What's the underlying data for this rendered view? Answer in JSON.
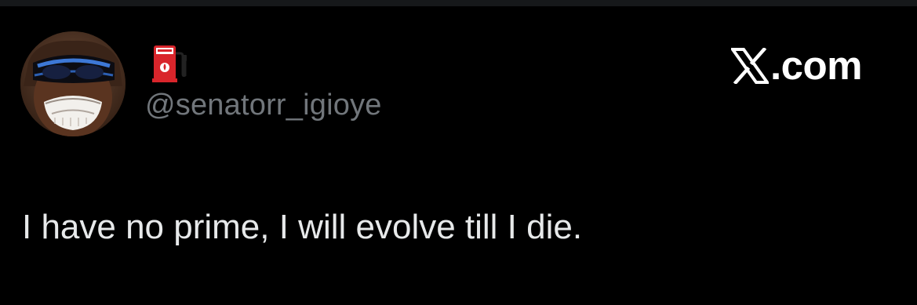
{
  "brand": {
    "icon": "x-logo-icon",
    "suffix": ".com"
  },
  "author": {
    "avatar_icon": "avatar-sunglasses-smile",
    "display_name_emoji": "fuel-pump-icon",
    "handle": "@senatorr_igioye"
  },
  "tweet": {
    "text": "I have no prime, I will evolve till I die."
  },
  "colors": {
    "background": "#000000",
    "text": "#e7e9ea",
    "secondary": "#71767b",
    "brand": "#ffffff",
    "emoji_red": "#d9252b"
  }
}
